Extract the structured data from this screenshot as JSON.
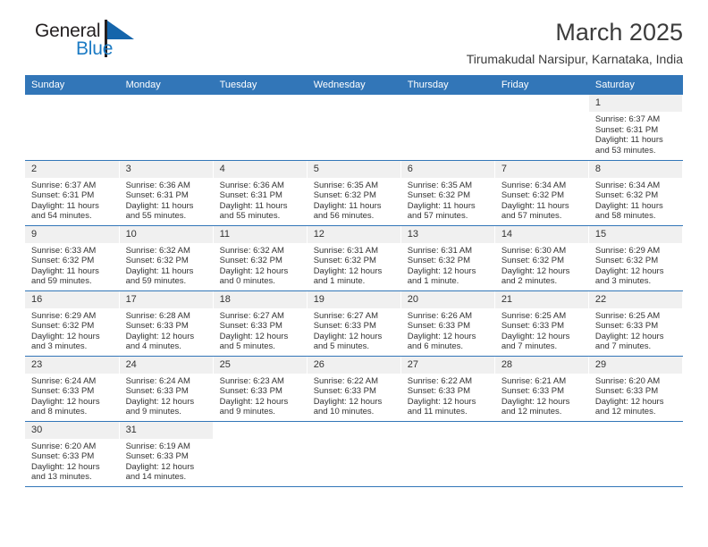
{
  "brand": {
    "name_part1": "General",
    "name_part2": "Blue",
    "colors": {
      "dark": "#231f20",
      "blue": "#1c7bc4",
      "flag": "#1565ab"
    }
  },
  "header": {
    "title": "March 2025",
    "subtitle": "Tirumakudal Narsipur, Karnataka, India"
  },
  "calendar": {
    "accent_color": "#3276b8",
    "daynum_band_color": "#f0f0f0",
    "weekdays": [
      "Sunday",
      "Monday",
      "Tuesday",
      "Wednesday",
      "Thursday",
      "Friday",
      "Saturday"
    ],
    "weeks": [
      [
        {
          "day": "",
          "empty": true
        },
        {
          "day": "",
          "empty": true
        },
        {
          "day": "",
          "empty": true
        },
        {
          "day": "",
          "empty": true
        },
        {
          "day": "",
          "empty": true
        },
        {
          "day": "",
          "empty": true
        },
        {
          "day": "1",
          "sunrise": "Sunrise: 6:37 AM",
          "sunset": "Sunset: 6:31 PM",
          "daylight1": "Daylight: 11 hours",
          "daylight2": "and 53 minutes."
        }
      ],
      [
        {
          "day": "2",
          "sunrise": "Sunrise: 6:37 AM",
          "sunset": "Sunset: 6:31 PM",
          "daylight1": "Daylight: 11 hours",
          "daylight2": "and 54 minutes."
        },
        {
          "day": "3",
          "sunrise": "Sunrise: 6:36 AM",
          "sunset": "Sunset: 6:31 PM",
          "daylight1": "Daylight: 11 hours",
          "daylight2": "and 55 minutes."
        },
        {
          "day": "4",
          "sunrise": "Sunrise: 6:36 AM",
          "sunset": "Sunset: 6:31 PM",
          "daylight1": "Daylight: 11 hours",
          "daylight2": "and 55 minutes."
        },
        {
          "day": "5",
          "sunrise": "Sunrise: 6:35 AM",
          "sunset": "Sunset: 6:32 PM",
          "daylight1": "Daylight: 11 hours",
          "daylight2": "and 56 minutes."
        },
        {
          "day": "6",
          "sunrise": "Sunrise: 6:35 AM",
          "sunset": "Sunset: 6:32 PM",
          "daylight1": "Daylight: 11 hours",
          "daylight2": "and 57 minutes."
        },
        {
          "day": "7",
          "sunrise": "Sunrise: 6:34 AM",
          "sunset": "Sunset: 6:32 PM",
          "daylight1": "Daylight: 11 hours",
          "daylight2": "and 57 minutes."
        },
        {
          "day": "8",
          "sunrise": "Sunrise: 6:34 AM",
          "sunset": "Sunset: 6:32 PM",
          "daylight1": "Daylight: 11 hours",
          "daylight2": "and 58 minutes."
        }
      ],
      [
        {
          "day": "9",
          "sunrise": "Sunrise: 6:33 AM",
          "sunset": "Sunset: 6:32 PM",
          "daylight1": "Daylight: 11 hours",
          "daylight2": "and 59 minutes."
        },
        {
          "day": "10",
          "sunrise": "Sunrise: 6:32 AM",
          "sunset": "Sunset: 6:32 PM",
          "daylight1": "Daylight: 11 hours",
          "daylight2": "and 59 minutes."
        },
        {
          "day": "11",
          "sunrise": "Sunrise: 6:32 AM",
          "sunset": "Sunset: 6:32 PM",
          "daylight1": "Daylight: 12 hours",
          "daylight2": "and 0 minutes."
        },
        {
          "day": "12",
          "sunrise": "Sunrise: 6:31 AM",
          "sunset": "Sunset: 6:32 PM",
          "daylight1": "Daylight: 12 hours",
          "daylight2": "and 1 minute."
        },
        {
          "day": "13",
          "sunrise": "Sunrise: 6:31 AM",
          "sunset": "Sunset: 6:32 PM",
          "daylight1": "Daylight: 12 hours",
          "daylight2": "and 1 minute."
        },
        {
          "day": "14",
          "sunrise": "Sunrise: 6:30 AM",
          "sunset": "Sunset: 6:32 PM",
          "daylight1": "Daylight: 12 hours",
          "daylight2": "and 2 minutes."
        },
        {
          "day": "15",
          "sunrise": "Sunrise: 6:29 AM",
          "sunset": "Sunset: 6:32 PM",
          "daylight1": "Daylight: 12 hours",
          "daylight2": "and 3 minutes."
        }
      ],
      [
        {
          "day": "16",
          "sunrise": "Sunrise: 6:29 AM",
          "sunset": "Sunset: 6:32 PM",
          "daylight1": "Daylight: 12 hours",
          "daylight2": "and 3 minutes."
        },
        {
          "day": "17",
          "sunrise": "Sunrise: 6:28 AM",
          "sunset": "Sunset: 6:33 PM",
          "daylight1": "Daylight: 12 hours",
          "daylight2": "and 4 minutes."
        },
        {
          "day": "18",
          "sunrise": "Sunrise: 6:27 AM",
          "sunset": "Sunset: 6:33 PM",
          "daylight1": "Daylight: 12 hours",
          "daylight2": "and 5 minutes."
        },
        {
          "day": "19",
          "sunrise": "Sunrise: 6:27 AM",
          "sunset": "Sunset: 6:33 PM",
          "daylight1": "Daylight: 12 hours",
          "daylight2": "and 5 minutes."
        },
        {
          "day": "20",
          "sunrise": "Sunrise: 6:26 AM",
          "sunset": "Sunset: 6:33 PM",
          "daylight1": "Daylight: 12 hours",
          "daylight2": "and 6 minutes."
        },
        {
          "day": "21",
          "sunrise": "Sunrise: 6:25 AM",
          "sunset": "Sunset: 6:33 PM",
          "daylight1": "Daylight: 12 hours",
          "daylight2": "and 7 minutes."
        },
        {
          "day": "22",
          "sunrise": "Sunrise: 6:25 AM",
          "sunset": "Sunset: 6:33 PM",
          "daylight1": "Daylight: 12 hours",
          "daylight2": "and 7 minutes."
        }
      ],
      [
        {
          "day": "23",
          "sunrise": "Sunrise: 6:24 AM",
          "sunset": "Sunset: 6:33 PM",
          "daylight1": "Daylight: 12 hours",
          "daylight2": "and 8 minutes."
        },
        {
          "day": "24",
          "sunrise": "Sunrise: 6:24 AM",
          "sunset": "Sunset: 6:33 PM",
          "daylight1": "Daylight: 12 hours",
          "daylight2": "and 9 minutes."
        },
        {
          "day": "25",
          "sunrise": "Sunrise: 6:23 AM",
          "sunset": "Sunset: 6:33 PM",
          "daylight1": "Daylight: 12 hours",
          "daylight2": "and 9 minutes."
        },
        {
          "day": "26",
          "sunrise": "Sunrise: 6:22 AM",
          "sunset": "Sunset: 6:33 PM",
          "daylight1": "Daylight: 12 hours",
          "daylight2": "and 10 minutes."
        },
        {
          "day": "27",
          "sunrise": "Sunrise: 6:22 AM",
          "sunset": "Sunset: 6:33 PM",
          "daylight1": "Daylight: 12 hours",
          "daylight2": "and 11 minutes."
        },
        {
          "day": "28",
          "sunrise": "Sunrise: 6:21 AM",
          "sunset": "Sunset: 6:33 PM",
          "daylight1": "Daylight: 12 hours",
          "daylight2": "and 12 minutes."
        },
        {
          "day": "29",
          "sunrise": "Sunrise: 6:20 AM",
          "sunset": "Sunset: 6:33 PM",
          "daylight1": "Daylight: 12 hours",
          "daylight2": "and 12 minutes."
        }
      ],
      [
        {
          "day": "30",
          "sunrise": "Sunrise: 6:20 AM",
          "sunset": "Sunset: 6:33 PM",
          "daylight1": "Daylight: 12 hours",
          "daylight2": "and 13 minutes."
        },
        {
          "day": "31",
          "sunrise": "Sunrise: 6:19 AM",
          "sunset": "Sunset: 6:33 PM",
          "daylight1": "Daylight: 12 hours",
          "daylight2": "and 14 minutes."
        },
        {
          "day": "",
          "empty": true
        },
        {
          "day": "",
          "empty": true
        },
        {
          "day": "",
          "empty": true
        },
        {
          "day": "",
          "empty": true
        },
        {
          "day": "",
          "empty": true
        }
      ]
    ]
  }
}
